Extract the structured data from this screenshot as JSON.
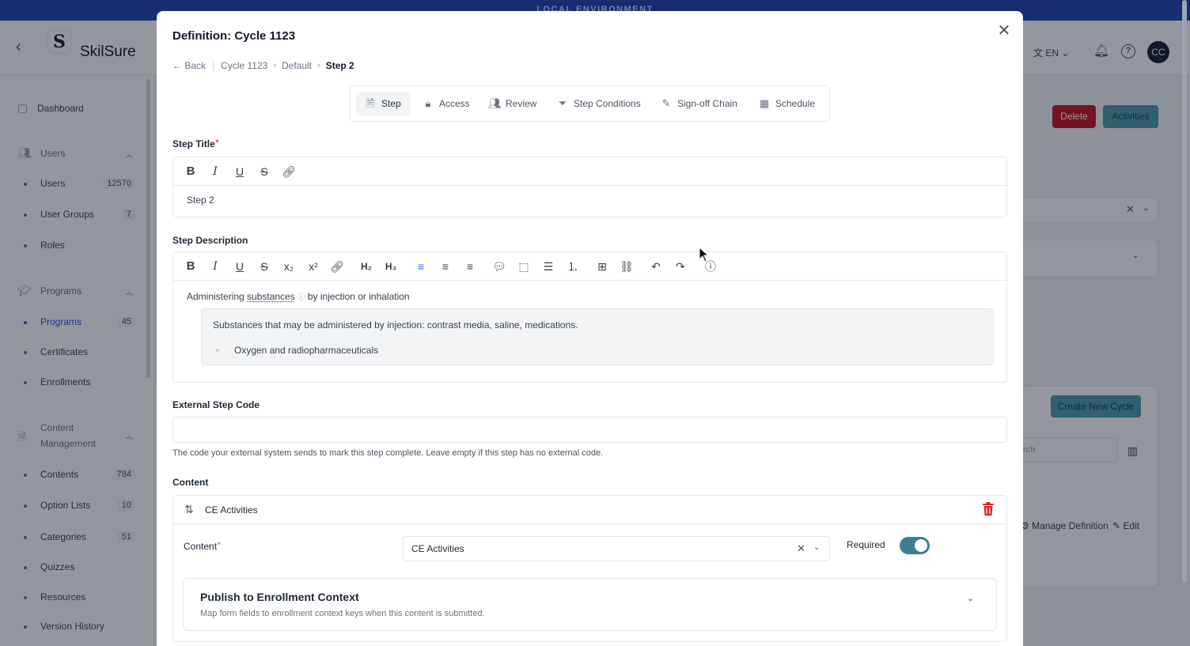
{
  "env_banner": "LOCAL ENVIRONMENT",
  "app": {
    "name": "SkilSure",
    "logo_letter": "S",
    "language": "EN",
    "avatar_initials": "CC"
  },
  "sidebar": {
    "dashboard": "Dashboard",
    "users_section": "Users",
    "users_items": [
      {
        "label": "Users",
        "count": "12570"
      },
      {
        "label": "User Groups",
        "count": "7"
      },
      {
        "label": "Roles",
        "count": ""
      }
    ],
    "programs_section": "Programs",
    "programs_items": [
      {
        "label": "Programs",
        "count": "45"
      },
      {
        "label": "Certificates",
        "count": ""
      },
      {
        "label": "Enrollments",
        "count": ""
      }
    ],
    "content_section_line1": "Content",
    "content_section_line2": "Management",
    "content_items": [
      {
        "label": "Contents",
        "count": "784"
      },
      {
        "label": "Option Lists",
        "count": "10"
      },
      {
        "label": "Categories",
        "count": "51"
      },
      {
        "label": "Quizzes",
        "count": ""
      },
      {
        "label": "Resources",
        "count": ""
      },
      {
        "label": "Version History",
        "count": ""
      }
    ]
  },
  "background": {
    "delete_label": "Delete",
    "activities_label": "Activities",
    "create_cycle_label": "Create New Cycle",
    "search_placeholder": "rch",
    "manage_definition_label": "Manage Definition",
    "edit_label": "Edit"
  },
  "modal": {
    "title": "Definition: Cycle 1123",
    "breadcrumb": {
      "back": "Back",
      "items": [
        "Cycle 1123",
        "Default",
        "Step 2"
      ]
    },
    "tabs": [
      {
        "label": "Step",
        "icon": "document-icon"
      },
      {
        "label": "Access",
        "icon": "lock-icon"
      },
      {
        "label": "Review",
        "icon": "people-icon"
      },
      {
        "label": "Step Conditions",
        "icon": "filter-icon"
      },
      {
        "label": "Sign-off Chain",
        "icon": "pen-icon"
      },
      {
        "label": "Schedule",
        "icon": "calendar-icon"
      }
    ],
    "step_title": {
      "label": "Step Title",
      "value": "Step 2"
    },
    "step_description": {
      "label": "Step Description",
      "text_before": "Administering ",
      "link_text": "substances",
      "text_after": " by injection or inhalation",
      "quote_line": "Substances that may be administered by injection: contrast media, saline, medications.",
      "quote_bullet": "Oxygen and radiopharmaceuticals"
    },
    "external_code": {
      "label": "External Step Code",
      "value": "",
      "helper": "The code your external system sends to mark this step complete. Leave empty if this step has no external code."
    },
    "content": {
      "section_label": "Content",
      "item_title": "CE Activities",
      "field_label": "Content",
      "selected_value": "CE Activities",
      "required_label": "Required",
      "required_on": true,
      "publish_title": "Publish to Enrollment Context",
      "publish_subtitle": "Map form fields to enrollment context keys when this content is submitted."
    }
  },
  "colors": {
    "env_bar": "#1e3fae",
    "accent_teal": "#4a9aa8",
    "delete_red": "#c1121f",
    "link_blue": "#1d4ed8"
  }
}
